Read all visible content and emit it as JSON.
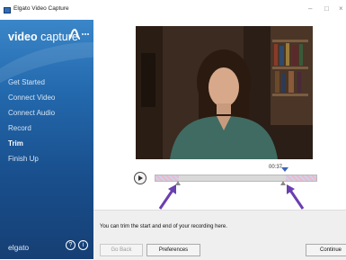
{
  "window": {
    "title": "Elgato Video Capture",
    "minimize": "–",
    "maximize": "□",
    "close": "×"
  },
  "sidebar": {
    "logo_bold": "video",
    "logo_light": " capture",
    "items": [
      {
        "label": "Get Started"
      },
      {
        "label": "Connect Video"
      },
      {
        "label": "Connect Audio"
      },
      {
        "label": "Record"
      },
      {
        "label": "Trim"
      },
      {
        "label": "Finish Up"
      }
    ],
    "active_item": "Trim",
    "brand": "elgato",
    "help_glyph": "?",
    "info_glyph": "i"
  },
  "player": {
    "time": "00:37",
    "play_icon": "play-icon"
  },
  "instruction": "You can trim the start and end of your recording here.",
  "buttons": {
    "back": "Go Back",
    "preferences": "Preferences",
    "continue": "Continue"
  },
  "colors": {
    "sidebar_top": "#3a86c8",
    "sidebar_bottom": "#163f74",
    "arrow": "#6a3fb0",
    "playhead": "#3a64b8"
  }
}
